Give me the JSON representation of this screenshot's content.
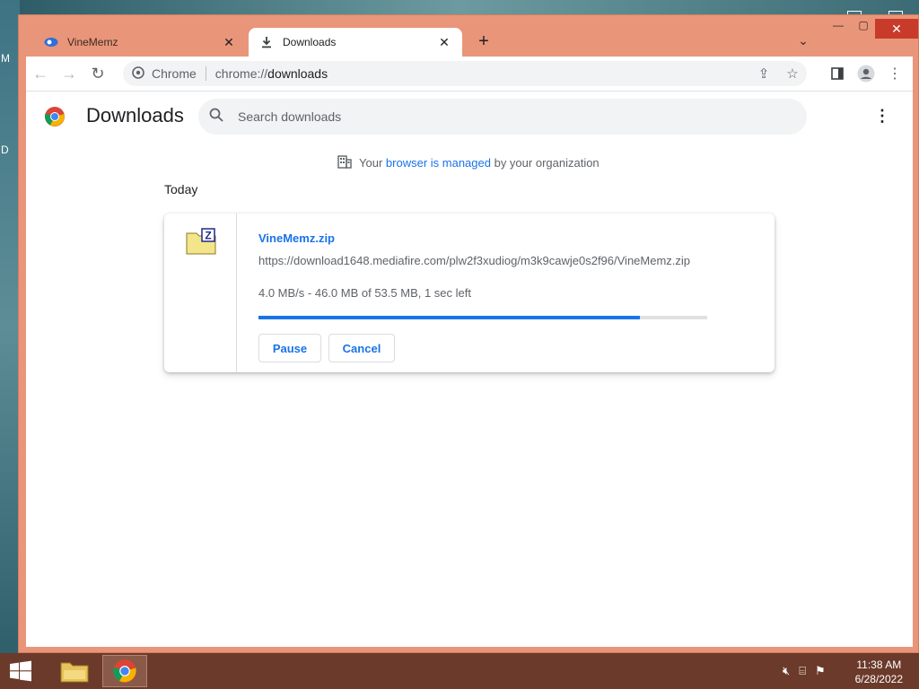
{
  "browser": {
    "tabs": [
      {
        "title": "VineMemz",
        "icon": "vinememz-favicon",
        "active": false
      },
      {
        "title": "Downloads",
        "icon": "download-icon",
        "active": true
      }
    ],
    "omnibox": {
      "site_label": "Chrome",
      "url_prefix": "chrome://",
      "url_path": "downloads"
    }
  },
  "page": {
    "title": "Downloads",
    "search_placeholder": "Search downloads",
    "managed_prefix": "Your",
    "managed_link": "browser is managed",
    "managed_suffix": "by your organization",
    "section_label": "Today"
  },
  "download": {
    "file_name": "VineMemz.zip",
    "url": "https://download1648.mediafire.com/plw2f3xudiog/m3k9cawje0s2f96/VineMemz.zip",
    "status": "4.0 MB/s - 46.0 MB of 53.5 MB, 1 sec left",
    "progress_percent": 85,
    "pause_label": "Pause",
    "cancel_label": "Cancel"
  },
  "taskbar": {
    "time": "11:38 AM",
    "date": "6/28/2022"
  },
  "colors": {
    "accent": "#1a73e8",
    "frame": "#e9957a",
    "taskbar": "#6b3a2a"
  }
}
